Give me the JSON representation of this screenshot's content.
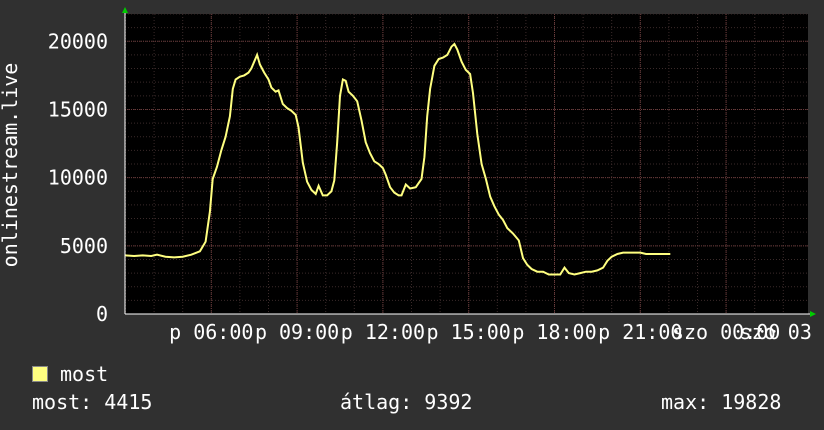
{
  "chart_data": {
    "type": "line",
    "ylabel": "onlinestream.live",
    "ylim": [
      0,
      22000
    ],
    "yticks": [
      0,
      5000,
      10000,
      15000,
      20000
    ],
    "xtick_labels": [
      "p 06:00",
      "p 09:00",
      "p 12:00",
      "p 15:00",
      "p 18:00",
      "p 21:00",
      "szo 00:00",
      "szo 03"
    ],
    "grid": true,
    "series": [
      {
        "name": "most",
        "color": "#ffff80",
        "points": [
          [
            0,
            4300
          ],
          [
            0.3,
            4250
          ],
          [
            0.6,
            4300
          ],
          [
            0.9,
            4250
          ],
          [
            1.1,
            4350
          ],
          [
            1.4,
            4200
          ],
          [
            1.7,
            4150
          ],
          [
            2.0,
            4200
          ],
          [
            2.3,
            4350
          ],
          [
            2.6,
            4600
          ],
          [
            2.8,
            5300
          ],
          [
            2.95,
            7500
          ],
          [
            3.05,
            9900
          ],
          [
            3.2,
            10800
          ],
          [
            3.35,
            12000
          ],
          [
            3.5,
            13000
          ],
          [
            3.65,
            14500
          ],
          [
            3.75,
            16500
          ],
          [
            3.85,
            17200
          ],
          [
            4.0,
            17400
          ],
          [
            4.15,
            17500
          ],
          [
            4.3,
            17700
          ],
          [
            4.4,
            18000
          ],
          [
            4.5,
            18500
          ],
          [
            4.6,
            19000
          ],
          [
            4.7,
            18300
          ],
          [
            4.85,
            17700
          ],
          [
            5.0,
            17200
          ],
          [
            5.1,
            16600
          ],
          [
            5.25,
            16300
          ],
          [
            5.35,
            16400
          ],
          [
            5.5,
            15400
          ],
          [
            5.65,
            15100
          ],
          [
            5.8,
            14900
          ],
          [
            5.95,
            14600
          ],
          [
            6.05,
            13700
          ],
          [
            6.2,
            11100
          ],
          [
            6.35,
            9700
          ],
          [
            6.5,
            9100
          ],
          [
            6.65,
            8800
          ],
          [
            6.75,
            9400
          ],
          [
            6.9,
            8700
          ],
          [
            7.05,
            8700
          ],
          [
            7.2,
            9000
          ],
          [
            7.3,
            9800
          ],
          [
            7.4,
            12500
          ],
          [
            7.5,
            16000
          ],
          [
            7.6,
            17200
          ],
          [
            7.7,
            17100
          ],
          [
            7.8,
            16300
          ],
          [
            7.95,
            16000
          ],
          [
            8.1,
            15600
          ],
          [
            8.25,
            14200
          ],
          [
            8.4,
            12600
          ],
          [
            8.55,
            11800
          ],
          [
            8.7,
            11200
          ],
          [
            8.85,
            11000
          ],
          [
            9.0,
            10700
          ],
          [
            9.1,
            10200
          ],
          [
            9.25,
            9300
          ],
          [
            9.4,
            8900
          ],
          [
            9.55,
            8700
          ],
          [
            9.65,
            8700
          ],
          [
            9.8,
            9500
          ],
          [
            9.95,
            9200
          ],
          [
            10.15,
            9300
          ],
          [
            10.35,
            9900
          ],
          [
            10.45,
            11500
          ],
          [
            10.55,
            14500
          ],
          [
            10.65,
            16500
          ],
          [
            10.8,
            18200
          ],
          [
            10.95,
            18700
          ],
          [
            11.1,
            18800
          ],
          [
            11.25,
            19000
          ],
          [
            11.4,
            19600
          ],
          [
            11.5,
            19800
          ],
          [
            11.6,
            19400
          ],
          [
            11.75,
            18500
          ],
          [
            11.9,
            17900
          ],
          [
            12.05,
            17600
          ],
          [
            12.15,
            16200
          ],
          [
            12.3,
            13200
          ],
          [
            12.45,
            11000
          ],
          [
            12.6,
            9900
          ],
          [
            12.75,
            8600
          ],
          [
            12.9,
            7900
          ],
          [
            13.05,
            7300
          ],
          [
            13.2,
            6900
          ],
          [
            13.35,
            6300
          ],
          [
            13.55,
            5900
          ],
          [
            13.75,
            5400
          ],
          [
            13.9,
            4100
          ],
          [
            14.05,
            3600
          ],
          [
            14.2,
            3300
          ],
          [
            14.4,
            3100
          ],
          [
            14.6,
            3100
          ],
          [
            14.8,
            2900
          ],
          [
            15.0,
            2900
          ],
          [
            15.2,
            2900
          ],
          [
            15.35,
            3400
          ],
          [
            15.5,
            3000
          ],
          [
            15.7,
            2900
          ],
          [
            15.9,
            3000
          ],
          [
            16.1,
            3100
          ],
          [
            16.3,
            3100
          ],
          [
            16.5,
            3200
          ],
          [
            16.7,
            3400
          ],
          [
            16.85,
            3900
          ],
          [
            17.0,
            4200
          ],
          [
            17.2,
            4400
          ],
          [
            17.4,
            4500
          ],
          [
            17.6,
            4500
          ],
          [
            17.8,
            4500
          ],
          [
            18.0,
            4500
          ],
          [
            18.2,
            4400
          ],
          [
            18.5,
            4400
          ],
          [
            18.8,
            4400
          ],
          [
            19.05,
            4400
          ]
        ]
      }
    ]
  },
  "legend": {
    "label": "most",
    "color": "#ffff80"
  },
  "stats": {
    "most": "most: 4415",
    "atlag": "átlag: 9392",
    "max": "max: 19828"
  }
}
